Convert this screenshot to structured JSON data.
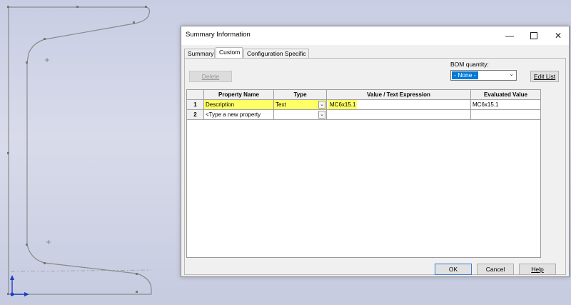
{
  "dialog": {
    "title": "Summary Information",
    "window_controls": {
      "minimize": "—",
      "maximize": "",
      "close": "✕"
    }
  },
  "tabs": [
    {
      "label": "Summary"
    },
    {
      "label": "Custom"
    },
    {
      "label": "Configuration Specific"
    }
  ],
  "toolbar": {
    "delete_label": "Delete",
    "bom_label": "BOM quantity:",
    "bom_value": "- None -",
    "edit_list_label": "Edit List"
  },
  "table": {
    "headers": [
      "",
      "Property Name",
      "Type",
      "Value / Text Expression",
      "Evaluated Value"
    ],
    "rows": [
      {
        "num": "1",
        "name": "Description",
        "type": "Text",
        "value": "MC6x15.1",
        "evaluated": "MC6x15.1"
      },
      {
        "num": "2",
        "name": "<Type a new property",
        "type": "",
        "value": "",
        "evaluated": ""
      }
    ]
  },
  "footer": {
    "ok_label": "OK",
    "cancel_label": "Cancel",
    "help_label": "Help"
  }
}
